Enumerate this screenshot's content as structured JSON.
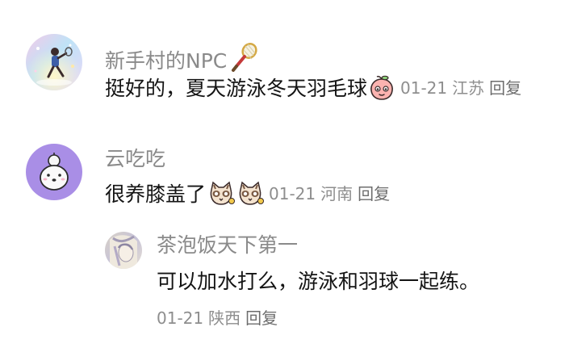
{
  "comments": [
    {
      "username": "新手村的NPC",
      "username_emoji": "badminton-racket-icon",
      "text": "挺好的，夏天游泳冬天羽毛球",
      "text_emoji": "peach-face-sticker-icon",
      "date": "01-21",
      "location": "江苏",
      "reply_label": "回复"
    },
    {
      "username": "云吃吃",
      "text": "很养膝盖了",
      "text_emojis": [
        "cat-face-sticker-icon",
        "cat-face-sticker-icon"
      ],
      "date": "01-21",
      "location": "河南",
      "reply_label": "回复",
      "replies": [
        {
          "username": "茶泡饭天下第一",
          "text": "可以加水打么，游泳和羽球一起练。",
          "date": "01-21",
          "location": "陕西",
          "reply_label": "回复"
        }
      ]
    }
  ],
  "colors": {
    "username": "#8a8a8a",
    "text": "#141414",
    "meta": "#8e8e8e",
    "avatar2_bg": "#a98ee6"
  }
}
